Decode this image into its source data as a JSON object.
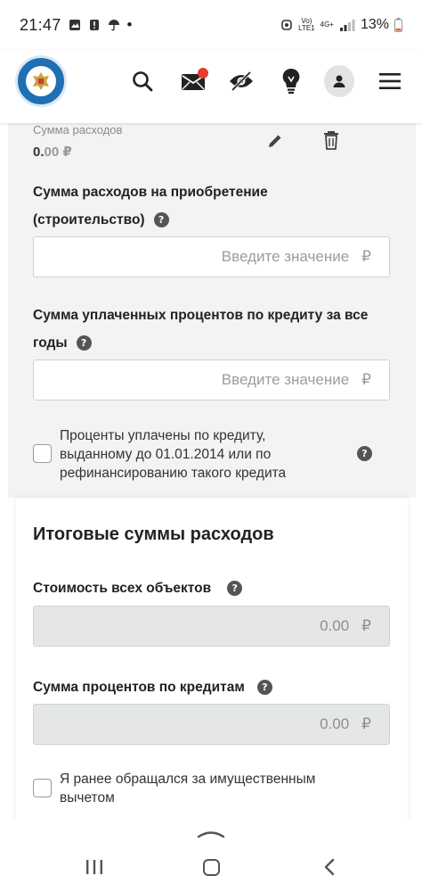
{
  "status_bar": {
    "time": "21:47",
    "dot": "•",
    "volte_top": "Vo)",
    "volte_bottom": "LTE1",
    "network": "4G+",
    "battery": "13%"
  },
  "header": {
    "icons": [
      "fns-logo",
      "search-icon",
      "mail-icon",
      "accessibility-eye-icon",
      "lightbulb-icon",
      "user-icon",
      "menu-icon"
    ],
    "notification_color": "#e63b2e"
  },
  "expense_item": {
    "label": "Сумма расходов",
    "value_int": "0.",
    "value_dec": "00 ₽"
  },
  "form": {
    "acquisition_label_line1": "Сумма расходов на приобретение",
    "acquisition_label_line2": "(строительство)",
    "acquisition_placeholder": "Введите значение",
    "currency": "₽",
    "interest_label_line1": "Сумма уплаченных процентов по кредиту за все",
    "interest_label_line2": "годы",
    "interest_placeholder": "Введите значение",
    "checkbox_text_line1": "Проценты уплачены по кредиту,",
    "checkbox_text_line2": "выданному до 01.01.2014 или по",
    "checkbox_text_line3": "рефинансированию такого кредита"
  },
  "totals": {
    "title": "Итоговые суммы расходов",
    "all_objects_label": "Стоимость всех объектов",
    "all_objects_value": "0.00",
    "loan_interest_label": "Сумма процентов по кредитам",
    "loan_interest_value": "0.00",
    "currency": "₽",
    "previous_deduction_line1": "Я ранее обращался за имущественным",
    "previous_deduction_line2": "вычетом"
  },
  "help_glyph": "?"
}
